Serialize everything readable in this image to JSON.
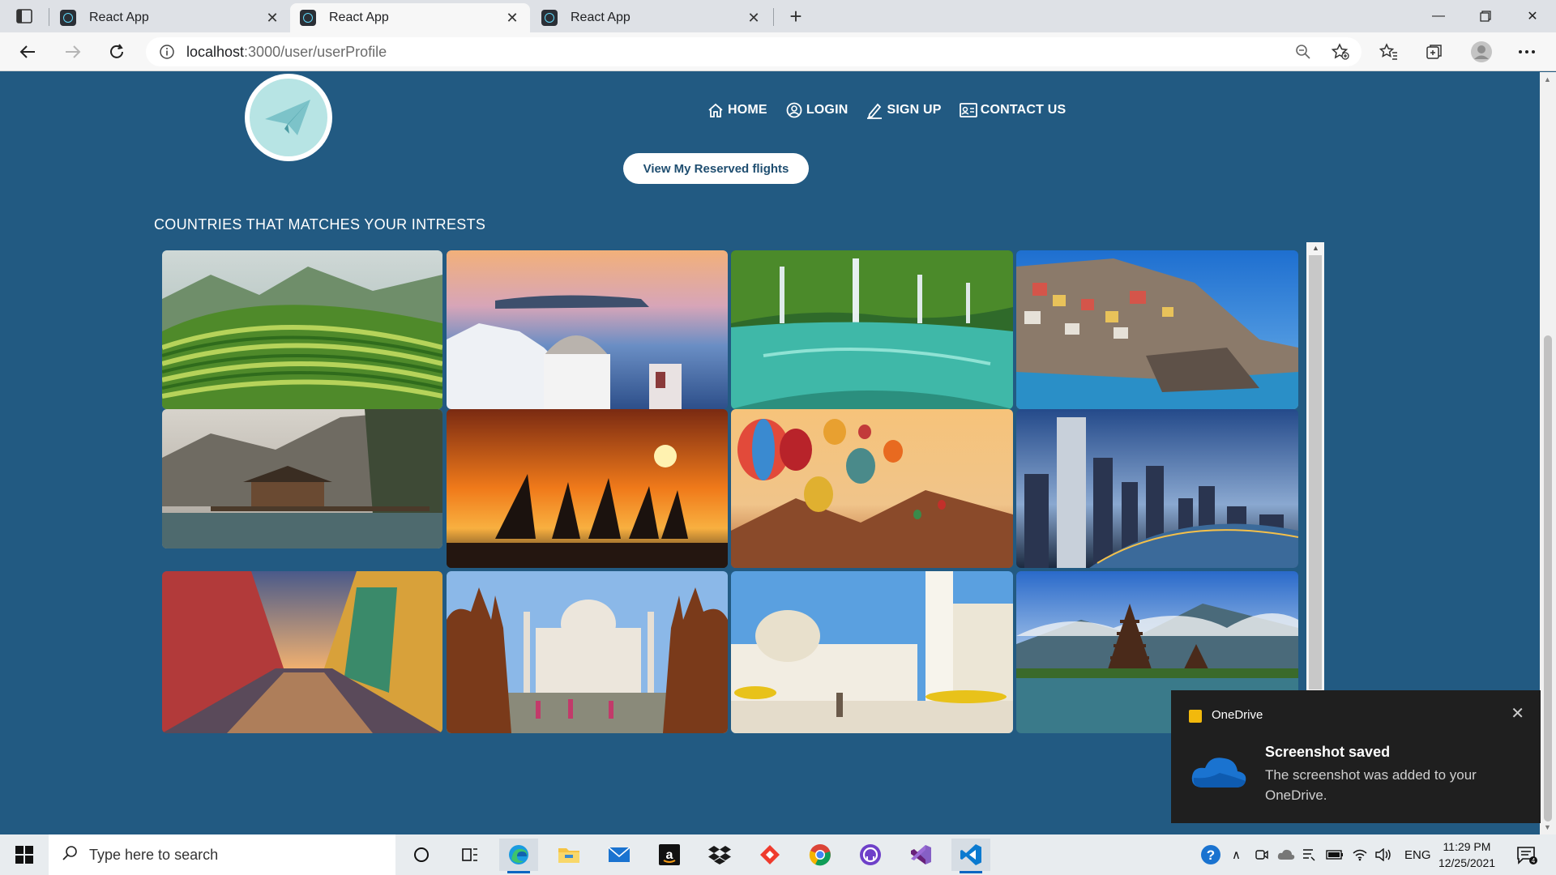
{
  "browser": {
    "tabs": [
      {
        "title": "React App",
        "active": false
      },
      {
        "title": "React App",
        "active": true
      },
      {
        "title": "React App",
        "active": false
      }
    ],
    "url_host": "localhost",
    "url_path": ":3000/user/userProfile"
  },
  "page": {
    "nav": [
      {
        "label": "HOME",
        "icon": "home-icon"
      },
      {
        "label": "LOGIN",
        "icon": "user-circle-icon"
      },
      {
        "label": "SIGN UP",
        "icon": "pencil-icon"
      },
      {
        "label": "CONTACT US",
        "icon": "contact-card-icon"
      }
    ],
    "reserved_button": "View My Reserved flights",
    "section_title": "COUNTRIES THAT MATCHES YOUR INTRESTS",
    "gallery": [
      {
        "name": "rice-terraces-image"
      },
      {
        "name": "santorini-image"
      },
      {
        "name": "waterfall-lake-image"
      },
      {
        "name": "cinque-terre-image"
      },
      {
        "name": "mountain-lake-cabin-image"
      },
      {
        "name": "sunset-sailboats-image"
      },
      {
        "name": "hot-air-balloons-image"
      },
      {
        "name": "city-skyline-image"
      },
      {
        "name": "venice-canal-image"
      },
      {
        "name": "taj-mahal-image"
      },
      {
        "name": "mosque-image"
      },
      {
        "name": "bali-temple-image"
      }
    ]
  },
  "toast": {
    "app": "OneDrive",
    "title": "Screenshot saved",
    "body": "The screenshot was added to your OneDrive."
  },
  "taskbar": {
    "search_placeholder": "Type here to search",
    "language": "ENG",
    "time": "11:29 PM",
    "date": "12/25/2021",
    "notifications": "4"
  },
  "colors": {
    "page_bg": "#225a82",
    "logo_bg": "#b7e4e4",
    "accent": "#0a66c2"
  }
}
